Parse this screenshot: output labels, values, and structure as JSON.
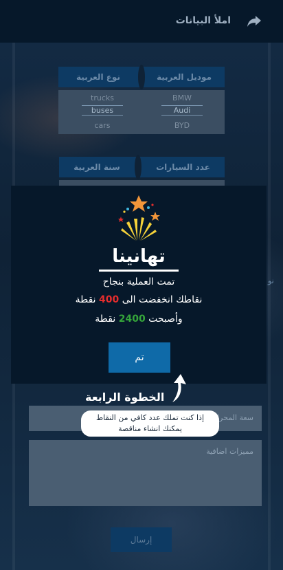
{
  "header": {
    "title": "املأ البيانات",
    "share_icon": "share-arrow-icon"
  },
  "car_type_picker": {
    "tabs": [
      "موديل العربية",
      "نوع العربية"
    ],
    "model_items": [
      "BMW",
      "Audi",
      "BYD"
    ],
    "type_items": [
      "trucks",
      "buses",
      "cars"
    ],
    "selected_model": "Audi",
    "selected_type": "buses"
  },
  "count_picker": {
    "tabs": [
      "عدد السيارات",
      "سنة العربية"
    ]
  },
  "modal": {
    "congrats": "تهانينا",
    "line1": "تمت العملية بنجاح",
    "line2_prefix": "نقاطك انخفضت الى",
    "line2_value": "400",
    "line2_suffix": "نقطة",
    "line3_prefix": "وأصبحت",
    "line3_value": "2400",
    "line3_suffix": "نقطة",
    "ok_label": "تم"
  },
  "tutorial": {
    "step_title": "الخطوة الرابعة",
    "hint_line1": "إذا كنت تملك عدد كافي من النقاط",
    "hint_line2": "يمكنك انشاء مناقصة"
  },
  "form": {
    "capacity_label": "سعة المحرك",
    "extra_features_label": "مميزات اضافية",
    "send_label": "إرسال",
    "partial_label": "نو"
  },
  "colors": {
    "accent": "#0f6aa8",
    "red": "#e52d2d",
    "green": "#35a63a",
    "header_bg": "#06182a"
  }
}
